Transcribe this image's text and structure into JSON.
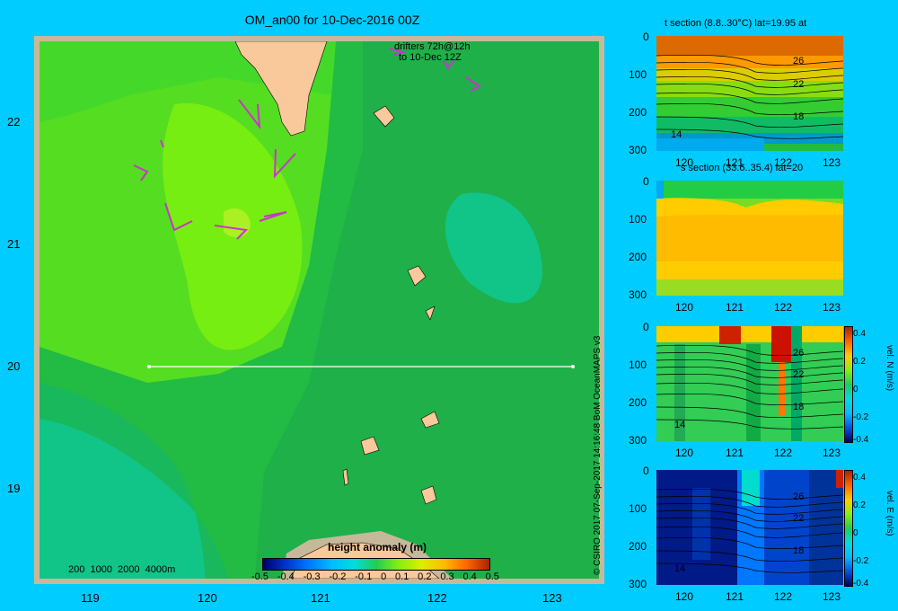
{
  "title": "OM_an00 for 10-Dec-2016 00Z",
  "map": {
    "lat_ticks": [
      "22",
      "21",
      "20",
      "19"
    ],
    "lon_ticks": [
      "119",
      "120",
      "121",
      "122",
      "123"
    ],
    "drifters_note_line1": "drifters 72h@12h",
    "drifters_note_line2": "to 10-Dec 12Z",
    "depth_legend": "200  1000  2000  4000m",
    "section_line_lat": 20,
    "section_line_lon": [
      119.5,
      123.2
    ],
    "colorbar": {
      "label": "height anomaly (m)",
      "ticks": [
        "-0.5",
        "-0.4",
        "-0.3",
        "-0.2",
        "-0.1",
        "0",
        "0.1",
        "0.2",
        "0.3",
        "0.4",
        "0.5"
      ],
      "range": [
        -0.5,
        0.5
      ]
    },
    "colors": {
      "land": "#f9c89b",
      "shelf": "#c8b89a",
      "arrows": "#cc33cc",
      "section_line": "#ffffff"
    }
  },
  "panels": [
    {
      "title": "t section (8.8..30°C) lat=19.95 at",
      "y_ticks": [
        "0",
        "100",
        "200",
        "300"
      ],
      "x_ticks": [
        "120",
        "121",
        "122",
        "123"
      ],
      "contour_labels": [
        "26",
        "22",
        "18",
        "14"
      ]
    },
    {
      "title": "s section (33.6..35.4) lat=20",
      "y_ticks": [
        "0",
        "100",
        "200",
        "300"
      ],
      "x_ticks": [
        "120",
        "121",
        "122",
        "123"
      ],
      "contour_labels": []
    },
    {
      "title": "",
      "y_ticks": [
        "0",
        "100",
        "200",
        "300"
      ],
      "x_ticks": [
        "120",
        "121",
        "122",
        "123"
      ],
      "contour_labels": [
        "26",
        "22",
        "18",
        "14"
      ],
      "cbar_ticks": [
        "0.4",
        "0.2",
        "0",
        "-0.2",
        "-0.4"
      ],
      "cbar_label": "vel. N (m/s)"
    },
    {
      "title": "",
      "y_ticks": [
        "0",
        "100",
        "200",
        "300"
      ],
      "x_ticks": [
        "120",
        "121",
        "122",
        "123"
      ],
      "contour_labels": [
        "26",
        "22",
        "18",
        "14"
      ],
      "cbar_ticks": [
        "0.4",
        "0.2",
        "0",
        "-0.2",
        "-0.4"
      ],
      "cbar_label": "vel. E (m/s)"
    }
  ],
  "credit": "© CSIRO 2017   07-Sep-2017 14:16:48 BoM OceanMAPS v3"
}
